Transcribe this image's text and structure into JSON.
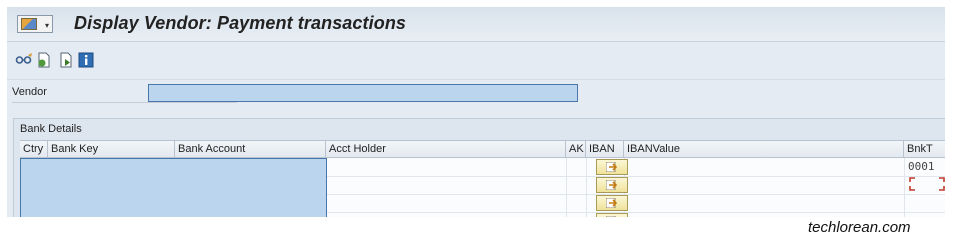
{
  "window": {
    "title": "Display Vendor: Payment transactions"
  },
  "toolbar": {
    "buttons": [
      {
        "icon": "glasses-display-icon"
      },
      {
        "icon": "other-vendor-icon"
      },
      {
        "icon": "next-screen-icon"
      },
      {
        "icon": "info-icon"
      }
    ]
  },
  "vendor": {
    "label": "Vendor",
    "value": ""
  },
  "bank_details": {
    "group_title": "Bank Details",
    "columns": [
      "Ctry",
      "Bank Key",
      "Bank Account",
      "Acct Holder",
      "AK",
      "IBAN",
      "IBANValue",
      "BnkT"
    ],
    "rows": [
      {
        "ctry": "",
        "bank_key": "",
        "bank_account": "",
        "acct_holder": "",
        "ak": "",
        "iban_value": "",
        "bnkt": "0001"
      },
      {
        "ctry": "",
        "bank_key": "",
        "bank_account": "",
        "acct_holder": "",
        "ak": "",
        "iban_value": "",
        "bnkt": ""
      },
      {
        "ctry": "",
        "bank_key": "",
        "bank_account": "",
        "acct_holder": "",
        "ak": "",
        "iban_value": "",
        "bnkt": ""
      },
      {
        "ctry": "",
        "bank_key": "",
        "bank_account": "",
        "acct_holder": "",
        "ak": "",
        "iban_value": "",
        "bnkt": ""
      }
    ]
  },
  "watermark": "techlorean.com",
  "colors": {
    "selection_fill": "#bcd5ee",
    "selection_border": "#4a77ab",
    "iban_button": "#efe29a",
    "cursor_red": "#c0392b"
  }
}
